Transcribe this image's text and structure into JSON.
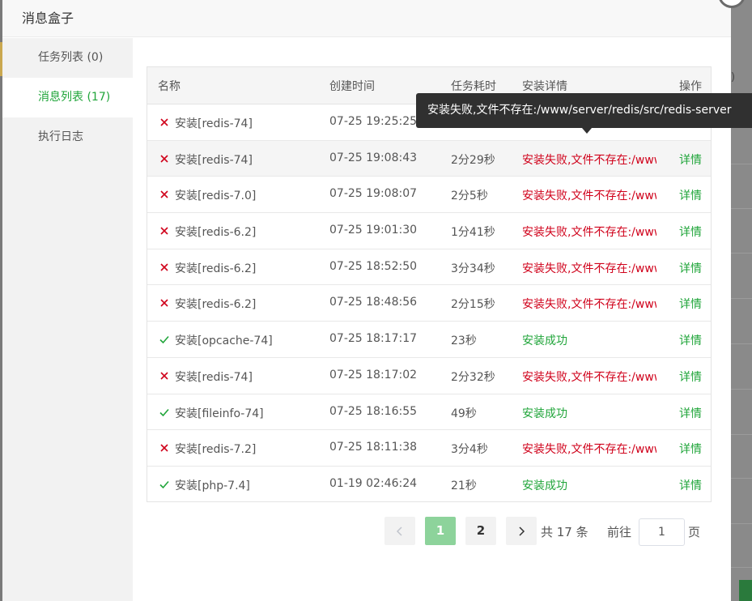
{
  "dialog": {
    "title": "消息盒子"
  },
  "sidebar": {
    "items": [
      {
        "label": "任务列表 (0)"
      },
      {
        "label": "消息列表 (17)"
      },
      {
        "label": "执行日志"
      }
    ],
    "active_index": 1
  },
  "table": {
    "headers": {
      "name": "名称",
      "time": "创建时间",
      "duration": "任务耗时",
      "detail": "安装详情",
      "op": "操作"
    },
    "rows": [
      {
        "status": "fail",
        "name": "安装[redis-74]",
        "time": "07-25 19:25:25",
        "duration": "",
        "detail": "",
        "op": ""
      },
      {
        "status": "fail",
        "name": "安装[redis-74]",
        "time": "07-25 19:08:43",
        "duration": "2分29秒",
        "detail": "安装失败,文件不存在:/www/server/redis/src/redis-server",
        "op": "详情"
      },
      {
        "status": "fail",
        "name": "安装[redis-7.0]",
        "time": "07-25 19:08:07",
        "duration": "2分5秒",
        "detail": "安装失败,文件不存在:/www/server/redis/src/redis-server",
        "op": "详情"
      },
      {
        "status": "fail",
        "name": "安装[redis-6.2]",
        "time": "07-25 19:01:30",
        "duration": "1分41秒",
        "detail": "安装失败,文件不存在:/www/server/redis/src/redis-server",
        "op": "详情"
      },
      {
        "status": "fail",
        "name": "安装[redis-6.2]",
        "time": "07-25 18:52:50",
        "duration": "3分34秒",
        "detail": "安装失败,文件不存在:/www/server/redis/src/redis-server",
        "op": "详情"
      },
      {
        "status": "fail",
        "name": "安装[redis-6.2]",
        "time": "07-25 18:48:56",
        "duration": "2分15秒",
        "detail": "安装失败,文件不存在:/www/server/redis/src/redis-server",
        "op": "详情"
      },
      {
        "status": "ok",
        "name": "安装[opcache-74]",
        "time": "07-25 18:17:17",
        "duration": "23秒",
        "detail": "安装成功",
        "op": "详情"
      },
      {
        "status": "fail",
        "name": "安装[redis-74]",
        "time": "07-25 18:17:02",
        "duration": "2分32秒",
        "detail": "安装失败,文件不存在:/www/server/redis/src/redis-server",
        "op": "详情"
      },
      {
        "status": "ok",
        "name": "安装[fileinfo-74]",
        "time": "07-25 18:16:55",
        "duration": "49秒",
        "detail": "安装成功",
        "op": "详情"
      },
      {
        "status": "fail",
        "name": "安装[redis-7.2]",
        "time": "07-25 18:11:38",
        "duration": "3分4秒",
        "detail": "安装失败,文件不存在:/www/server/redis/src/redis-server",
        "op": "详情"
      },
      {
        "status": "ok",
        "name": "安装[php-7.4]",
        "time": "01-19 02:46:24",
        "duration": "21秒",
        "detail": "安装成功",
        "op": "详情"
      }
    ]
  },
  "tooltip": {
    "text": "安装失败,文件不存在:/www/server/redis/src/redis-server"
  },
  "pagination": {
    "prev_icon": "chevron-left-icon",
    "next_icon": "chevron-right-icon",
    "pages": [
      "1",
      "2"
    ],
    "current_page": "1",
    "total_text": "共 17 条",
    "goto_label": "前往",
    "goto_value": "1",
    "page_suffix": "页"
  },
  "colors": {
    "accent": "#20a53a",
    "error": "#d0021b",
    "active_page": "#8dd39b"
  }
}
